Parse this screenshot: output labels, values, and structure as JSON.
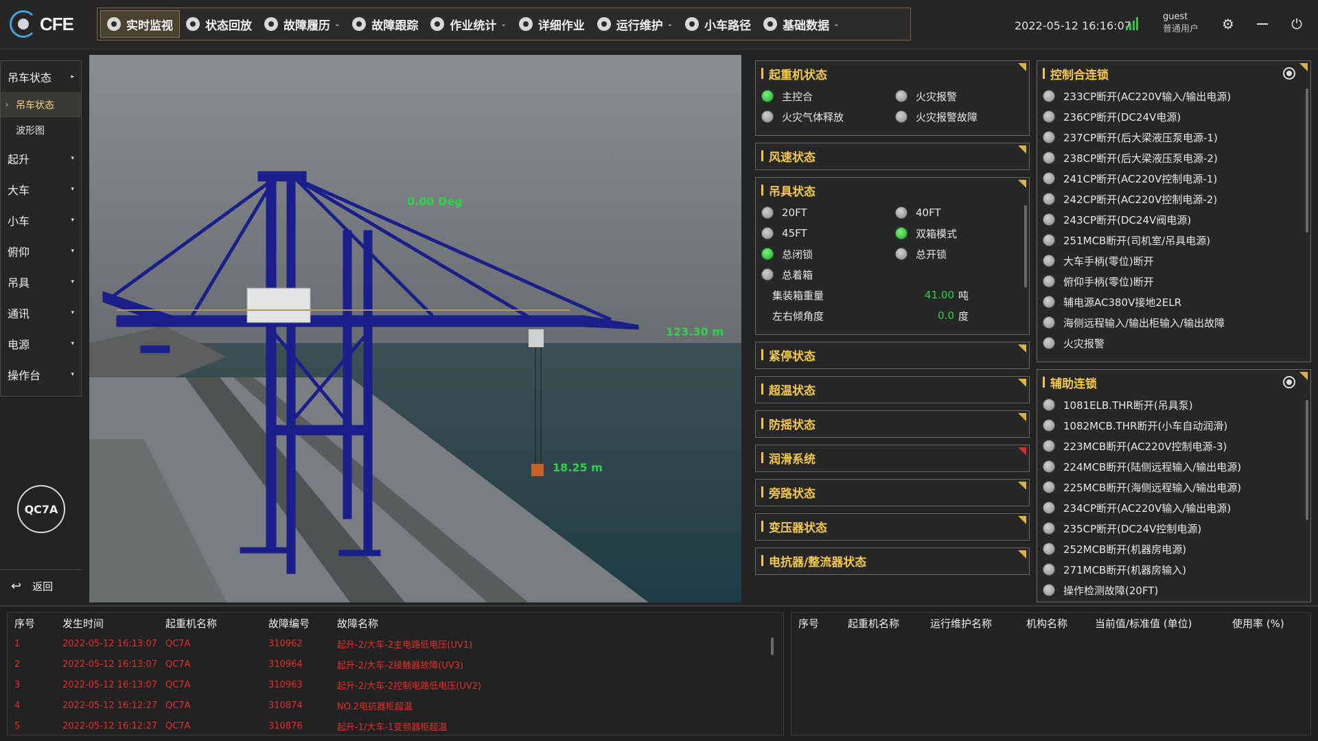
{
  "logo": {
    "text": "CFE"
  },
  "nav": {
    "items": [
      {
        "label": "实时监视",
        "active": true,
        "has_caret": false
      },
      {
        "label": "状态回放",
        "active": false,
        "has_caret": false
      },
      {
        "label": "故障履历",
        "active": false,
        "has_caret": true
      },
      {
        "label": "故障跟踪",
        "active": false,
        "has_caret": false
      },
      {
        "label": "作业统计",
        "active": false,
        "has_caret": true
      },
      {
        "label": "详细作业",
        "active": false,
        "has_caret": false
      },
      {
        "label": "运行维护",
        "active": false,
        "has_caret": true
      },
      {
        "label": "小车路径",
        "active": false,
        "has_caret": false
      },
      {
        "label": "基础数据",
        "active": false,
        "has_caret": true
      }
    ]
  },
  "header": {
    "datetime": "2022-05-12 16:16:07",
    "signal_icon": "signal-bars-icon",
    "user_name": "guest",
    "user_role": "普通用户",
    "icons": [
      "gear-icon",
      "minimize-icon",
      "power-icon"
    ]
  },
  "sidebar": {
    "items": [
      {
        "label": "吊车状态",
        "caret": "▸"
      },
      {
        "label": "起升",
        "caret": "▾"
      },
      {
        "label": "大车",
        "caret": "▾"
      },
      {
        "label": "小车",
        "caret": "▾"
      },
      {
        "label": "俯仰",
        "caret": "▾"
      },
      {
        "label": "吊具",
        "caret": "▾"
      },
      {
        "label": "通讯",
        "caret": "▾"
      },
      {
        "label": "电源",
        "caret": "▾"
      },
      {
        "label": "操作台",
        "caret": "▾"
      }
    ],
    "subitems": [
      {
        "label": "吊车状态",
        "active": true
      },
      {
        "label": "波形图",
        "active": false
      }
    ],
    "crane_id": "QC7A",
    "back_label": "返回"
  },
  "scene": {
    "boom_angle": "0.00 Deg",
    "trolley_position": "123.30 m",
    "hoist_height": "18.25 m"
  },
  "panels": {
    "crane_status": {
      "title": "起重机状态",
      "indicators": [
        {
          "label": "主控合",
          "on": true
        },
        {
          "label": "火灾报警",
          "on": false
        },
        {
          "label": "火灾气体释放",
          "on": false
        },
        {
          "label": "火灾报警故障",
          "on": false
        }
      ]
    },
    "wind": {
      "title": "风速状态"
    },
    "spreader": {
      "title": "吊具状态",
      "indicators": [
        {
          "label": "20FT",
          "on": false
        },
        {
          "label": "40FT",
          "on": false
        },
        {
          "label": "45FT",
          "on": false
        },
        {
          "label": "双箱模式",
          "on": true
        },
        {
          "label": "总闭锁",
          "on": true
        },
        {
          "label": "总开锁",
          "on": false
        },
        {
          "label": "总着箱",
          "on": false
        }
      ],
      "container_weight_label": "集装箱重量",
      "container_weight_value": "41.00",
      "container_weight_unit": "吨",
      "tilt_label": "左右倾角度",
      "tilt_value": "0.0",
      "tilt_unit": "度"
    },
    "collapsed": [
      {
        "title": "紧停状态",
        "alert": false
      },
      {
        "title": "超温状态",
        "alert": false
      },
      {
        "title": "防摇状态",
        "alert": false
      },
      {
        "title": "润滑系统",
        "alert": true
      },
      {
        "title": "旁路状态",
        "alert": false
      },
      {
        "title": "变压器状态",
        "alert": false
      },
      {
        "title": "电抗器/整流器状态",
        "alert": false
      }
    ],
    "control_interlock": {
      "title": "控制合连锁",
      "items": [
        "233CP断开(AC220V输入/输出电源)",
        "236CP断开(DC24V电源)",
        "237CP断开(后大梁液压泵电源-1)",
        "238CP断开(后大梁液压泵电源-2)",
        "241CP断开(AC220V控制电源-1)",
        "242CP断开(AC220V控制电源-2)",
        "243CP断开(DC24V阀电源)",
        "251MCB断开(司机室/吊具电源)",
        "大车手柄(零位)断开",
        "俯仰手柄(零位)断开",
        "辅电源AC380V接地2ELR",
        "海侧远程输入/输出柜输入/输出故障",
        "火灾报警"
      ]
    },
    "aux_interlock": {
      "title": "辅助连锁",
      "items": [
        "1081ELB.THR断开(吊具泵)",
        "1082MCB.THR断开(小车自动润滑)",
        "223MCB断开(AC220V控制电源-3)",
        "224MCB断开(陆侧远程输入/输出电源)",
        "225MCB断开(海侧远程输入/输出电源)",
        "234CP断开(AC220V输入/输出电源)",
        "235CP断开(DC24V控制电源)",
        "252MCB断开(机器房电源)",
        "271MCB断开(机器房输入)",
        "操作检测故障(20FT)"
      ]
    }
  },
  "fault_table": {
    "columns": [
      "序号",
      "发生时间",
      "起重机名称",
      "故障编号",
      "故障名称"
    ],
    "rows": [
      {
        "no": "1",
        "time": "2022-05-12 16:13:07",
        "crane": "QC7A",
        "code": "310962",
        "name": "起升-2/大车-2主电路低电压(UV1)"
      },
      {
        "no": "2",
        "time": "2022-05-12 16:13:07",
        "crane": "QC7A",
        "code": "310964",
        "name": "起升-2/大车-2接触器故障(UV3)"
      },
      {
        "no": "3",
        "time": "2022-05-12 16:13:07",
        "crane": "QC7A",
        "code": "310963",
        "name": "起升-2/大车-2控制电路低电压(UV2)"
      },
      {
        "no": "4",
        "time": "2022-05-12 16:12:27",
        "crane": "QC7A",
        "code": "310874",
        "name": "NO.2电抗器柜超温"
      },
      {
        "no": "5",
        "time": "2022-05-12 16:12:27",
        "crane": "QC7A",
        "code": "310876",
        "name": "起升-1/大车-1变频器柜超温"
      }
    ]
  },
  "maintenance_table": {
    "columns": [
      "序号",
      "起重机名称",
      "运行维护名称",
      "机构名称",
      "当前值/标准值 (单位)",
      "使用率 (%)"
    ]
  },
  "colors": {
    "accent": "#f2c84b",
    "ok": "#1ea531",
    "alarm": "#e0322d",
    "crane_blue": "#1b1f8a"
  }
}
